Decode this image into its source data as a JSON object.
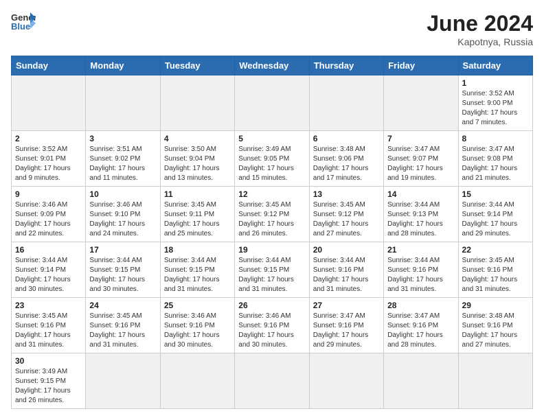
{
  "header": {
    "logo_text_general": "General",
    "logo_text_blue": "Blue",
    "month_year": "June 2024",
    "location": "Kapotnya, Russia"
  },
  "weekdays": [
    "Sunday",
    "Monday",
    "Tuesday",
    "Wednesday",
    "Thursday",
    "Friday",
    "Saturday"
  ],
  "weeks": [
    [
      {
        "day": "",
        "empty": true
      },
      {
        "day": "",
        "empty": true
      },
      {
        "day": "",
        "empty": true
      },
      {
        "day": "",
        "empty": true
      },
      {
        "day": "",
        "empty": true
      },
      {
        "day": "",
        "empty": true
      },
      {
        "day": "1",
        "sunrise": "Sunrise: 3:52 AM",
        "sunset": "Sunset: 9:00 PM",
        "daylight": "Daylight: 17 hours and 7 minutes."
      }
    ],
    [
      {
        "day": "2",
        "sunrise": "Sunrise: 3:52 AM",
        "sunset": "Sunset: 9:01 PM",
        "daylight": "Daylight: 17 hours and 9 minutes."
      },
      {
        "day": "3",
        "sunrise": "Sunrise: 3:51 AM",
        "sunset": "Sunset: 9:02 PM",
        "daylight": "Daylight: 17 hours and 11 minutes."
      },
      {
        "day": "4",
        "sunrise": "Sunrise: 3:50 AM",
        "sunset": "Sunset: 9:04 PM",
        "daylight": "Daylight: 17 hours and 13 minutes."
      },
      {
        "day": "5",
        "sunrise": "Sunrise: 3:49 AM",
        "sunset": "Sunset: 9:05 PM",
        "daylight": "Daylight: 17 hours and 15 minutes."
      },
      {
        "day": "6",
        "sunrise": "Sunrise: 3:48 AM",
        "sunset": "Sunset: 9:06 PM",
        "daylight": "Daylight: 17 hours and 17 minutes."
      },
      {
        "day": "7",
        "sunrise": "Sunrise: 3:47 AM",
        "sunset": "Sunset: 9:07 PM",
        "daylight": "Daylight: 17 hours and 19 minutes."
      },
      {
        "day": "8",
        "sunrise": "Sunrise: 3:47 AM",
        "sunset": "Sunset: 9:08 PM",
        "daylight": "Daylight: 17 hours and 21 minutes."
      }
    ],
    [
      {
        "day": "9",
        "sunrise": "Sunrise: 3:46 AM",
        "sunset": "Sunset: 9:09 PM",
        "daylight": "Daylight: 17 hours and 22 minutes."
      },
      {
        "day": "10",
        "sunrise": "Sunrise: 3:46 AM",
        "sunset": "Sunset: 9:10 PM",
        "daylight": "Daylight: 17 hours and 24 minutes."
      },
      {
        "day": "11",
        "sunrise": "Sunrise: 3:45 AM",
        "sunset": "Sunset: 9:11 PM",
        "daylight": "Daylight: 17 hours and 25 minutes."
      },
      {
        "day": "12",
        "sunrise": "Sunrise: 3:45 AM",
        "sunset": "Sunset: 9:12 PM",
        "daylight": "Daylight: 17 hours and 26 minutes."
      },
      {
        "day": "13",
        "sunrise": "Sunrise: 3:45 AM",
        "sunset": "Sunset: 9:12 PM",
        "daylight": "Daylight: 17 hours and 27 minutes."
      },
      {
        "day": "14",
        "sunrise": "Sunrise: 3:44 AM",
        "sunset": "Sunset: 9:13 PM",
        "daylight": "Daylight: 17 hours and 28 minutes."
      },
      {
        "day": "15",
        "sunrise": "Sunrise: 3:44 AM",
        "sunset": "Sunset: 9:14 PM",
        "daylight": "Daylight: 17 hours and 29 minutes."
      }
    ],
    [
      {
        "day": "16",
        "sunrise": "Sunrise: 3:44 AM",
        "sunset": "Sunset: 9:14 PM",
        "daylight": "Daylight: 17 hours and 30 minutes."
      },
      {
        "day": "17",
        "sunrise": "Sunrise: 3:44 AM",
        "sunset": "Sunset: 9:15 PM",
        "daylight": "Daylight: 17 hours and 30 minutes."
      },
      {
        "day": "18",
        "sunrise": "Sunrise: 3:44 AM",
        "sunset": "Sunset: 9:15 PM",
        "daylight": "Daylight: 17 hours and 31 minutes."
      },
      {
        "day": "19",
        "sunrise": "Sunrise: 3:44 AM",
        "sunset": "Sunset: 9:15 PM",
        "daylight": "Daylight: 17 hours and 31 minutes."
      },
      {
        "day": "20",
        "sunrise": "Sunrise: 3:44 AM",
        "sunset": "Sunset: 9:16 PM",
        "daylight": "Daylight: 17 hours and 31 minutes."
      },
      {
        "day": "21",
        "sunrise": "Sunrise: 3:44 AM",
        "sunset": "Sunset: 9:16 PM",
        "daylight": "Daylight: 17 hours and 31 minutes."
      },
      {
        "day": "22",
        "sunrise": "Sunrise: 3:45 AM",
        "sunset": "Sunset: 9:16 PM",
        "daylight": "Daylight: 17 hours and 31 minutes."
      }
    ],
    [
      {
        "day": "23",
        "sunrise": "Sunrise: 3:45 AM",
        "sunset": "Sunset: 9:16 PM",
        "daylight": "Daylight: 17 hours and 31 minutes."
      },
      {
        "day": "24",
        "sunrise": "Sunrise: 3:45 AM",
        "sunset": "Sunset: 9:16 PM",
        "daylight": "Daylight: 17 hours and 31 minutes."
      },
      {
        "day": "25",
        "sunrise": "Sunrise: 3:46 AM",
        "sunset": "Sunset: 9:16 PM",
        "daylight": "Daylight: 17 hours and 30 minutes."
      },
      {
        "day": "26",
        "sunrise": "Sunrise: 3:46 AM",
        "sunset": "Sunset: 9:16 PM",
        "daylight": "Daylight: 17 hours and 30 minutes."
      },
      {
        "day": "27",
        "sunrise": "Sunrise: 3:47 AM",
        "sunset": "Sunset: 9:16 PM",
        "daylight": "Daylight: 17 hours and 29 minutes."
      },
      {
        "day": "28",
        "sunrise": "Sunrise: 3:47 AM",
        "sunset": "Sunset: 9:16 PM",
        "daylight": "Daylight: 17 hours and 28 minutes."
      },
      {
        "day": "29",
        "sunrise": "Sunrise: 3:48 AM",
        "sunset": "Sunset: 9:16 PM",
        "daylight": "Daylight: 17 hours and 27 minutes."
      }
    ],
    [
      {
        "day": "30",
        "sunrise": "Sunrise: 3:49 AM",
        "sunset": "Sunset: 9:15 PM",
        "daylight": "Daylight: 17 hours and 26 minutes."
      },
      {
        "day": "",
        "empty": true
      },
      {
        "day": "",
        "empty": true
      },
      {
        "day": "",
        "empty": true
      },
      {
        "day": "",
        "empty": true
      },
      {
        "day": "",
        "empty": true
      },
      {
        "day": "",
        "empty": true
      }
    ]
  ]
}
